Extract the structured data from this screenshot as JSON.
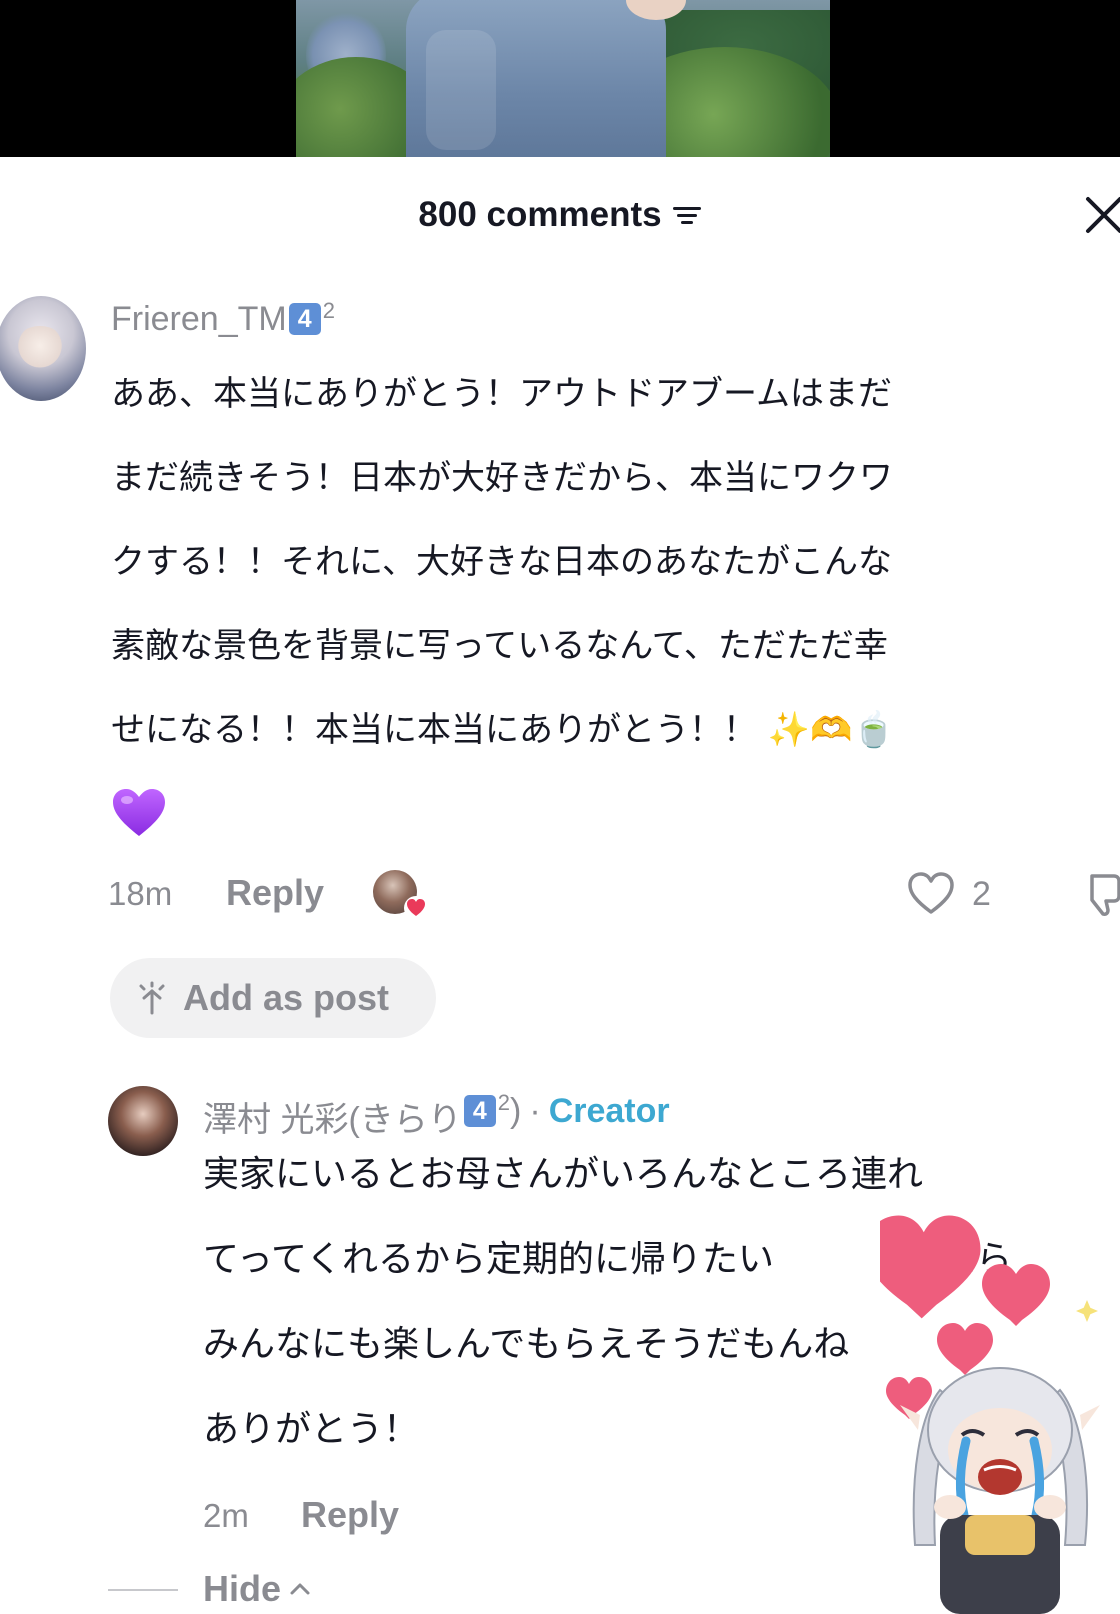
{
  "header": {
    "title": "800 comments",
    "filter_icon": "filter-icon",
    "close_icon": "close-icon"
  },
  "comment": {
    "username": "Frieren_TM",
    "badge": "4",
    "badge_sup": "2",
    "lines": [
      "ああ、本当にありがとう！アウトドアブームはまだ",
      "まだ続きそう！日本が大好きだから、本当にワクワ",
      "クする！！それに、大好きな日本のあなたがこんな",
      "素敵な景色を背景に写っているなんて、ただただ幸",
      "せになる！！本当に本当にありがとう！！"
    ],
    "emoji_tail": [
      "✨",
      "🫶",
      "🍵",
      "💜"
    ],
    "time": "18m",
    "reply_label": "Reply",
    "like_count": "2",
    "add_as_post": "Add as post"
  },
  "reply": {
    "username": "澤村 光彩(きらり",
    "badge": "4",
    "badge_sup": "2",
    "username_close": ")",
    "separator": "·",
    "creator_label": "Creator",
    "lines": [
      "実家にいるとお母さんがいろんなところ連れ",
      "てってくれるから定期的に帰りたい",
      "みんなにも楽しんでもらえそうだもんね",
      "ありがとう！"
    ],
    "line2_tail": "したら",
    "time": "2m",
    "reply_label": "Reply",
    "hide_label": "Hide"
  },
  "colors": {
    "accent_creator": "#3da8d1",
    "badge_blue": "#5e8fd6",
    "muted_text": "#8a8b91",
    "like_heart": "#ea3a5a"
  }
}
